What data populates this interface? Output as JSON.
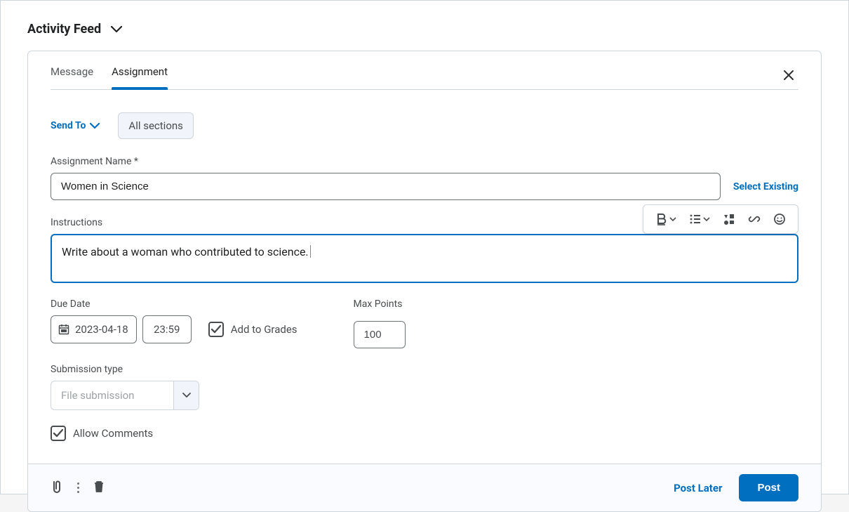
{
  "header": {
    "title": "Activity Feed"
  },
  "tabs": {
    "message": "Message",
    "assignment": "Assignment"
  },
  "send_to": {
    "label": "Send To",
    "chip": "All sections"
  },
  "assignment_name": {
    "label": "Assignment Name *",
    "value": "Women in Science",
    "select_existing": "Select Existing"
  },
  "instructions": {
    "label": "Instructions",
    "value": "Write about a woman who contributed to science."
  },
  "due_date": {
    "label": "Due Date",
    "date": "2023-04-18",
    "time": "23:59"
  },
  "add_to_grades": {
    "label": "Add to Grades",
    "checked": true
  },
  "max_points": {
    "label": "Max Points",
    "value": "100"
  },
  "submission": {
    "label": "Submission type",
    "value": "File submission"
  },
  "allow_comments": {
    "label": "Allow Comments",
    "checked": true
  },
  "footer": {
    "post_later": "Post Later",
    "post": "Post"
  }
}
